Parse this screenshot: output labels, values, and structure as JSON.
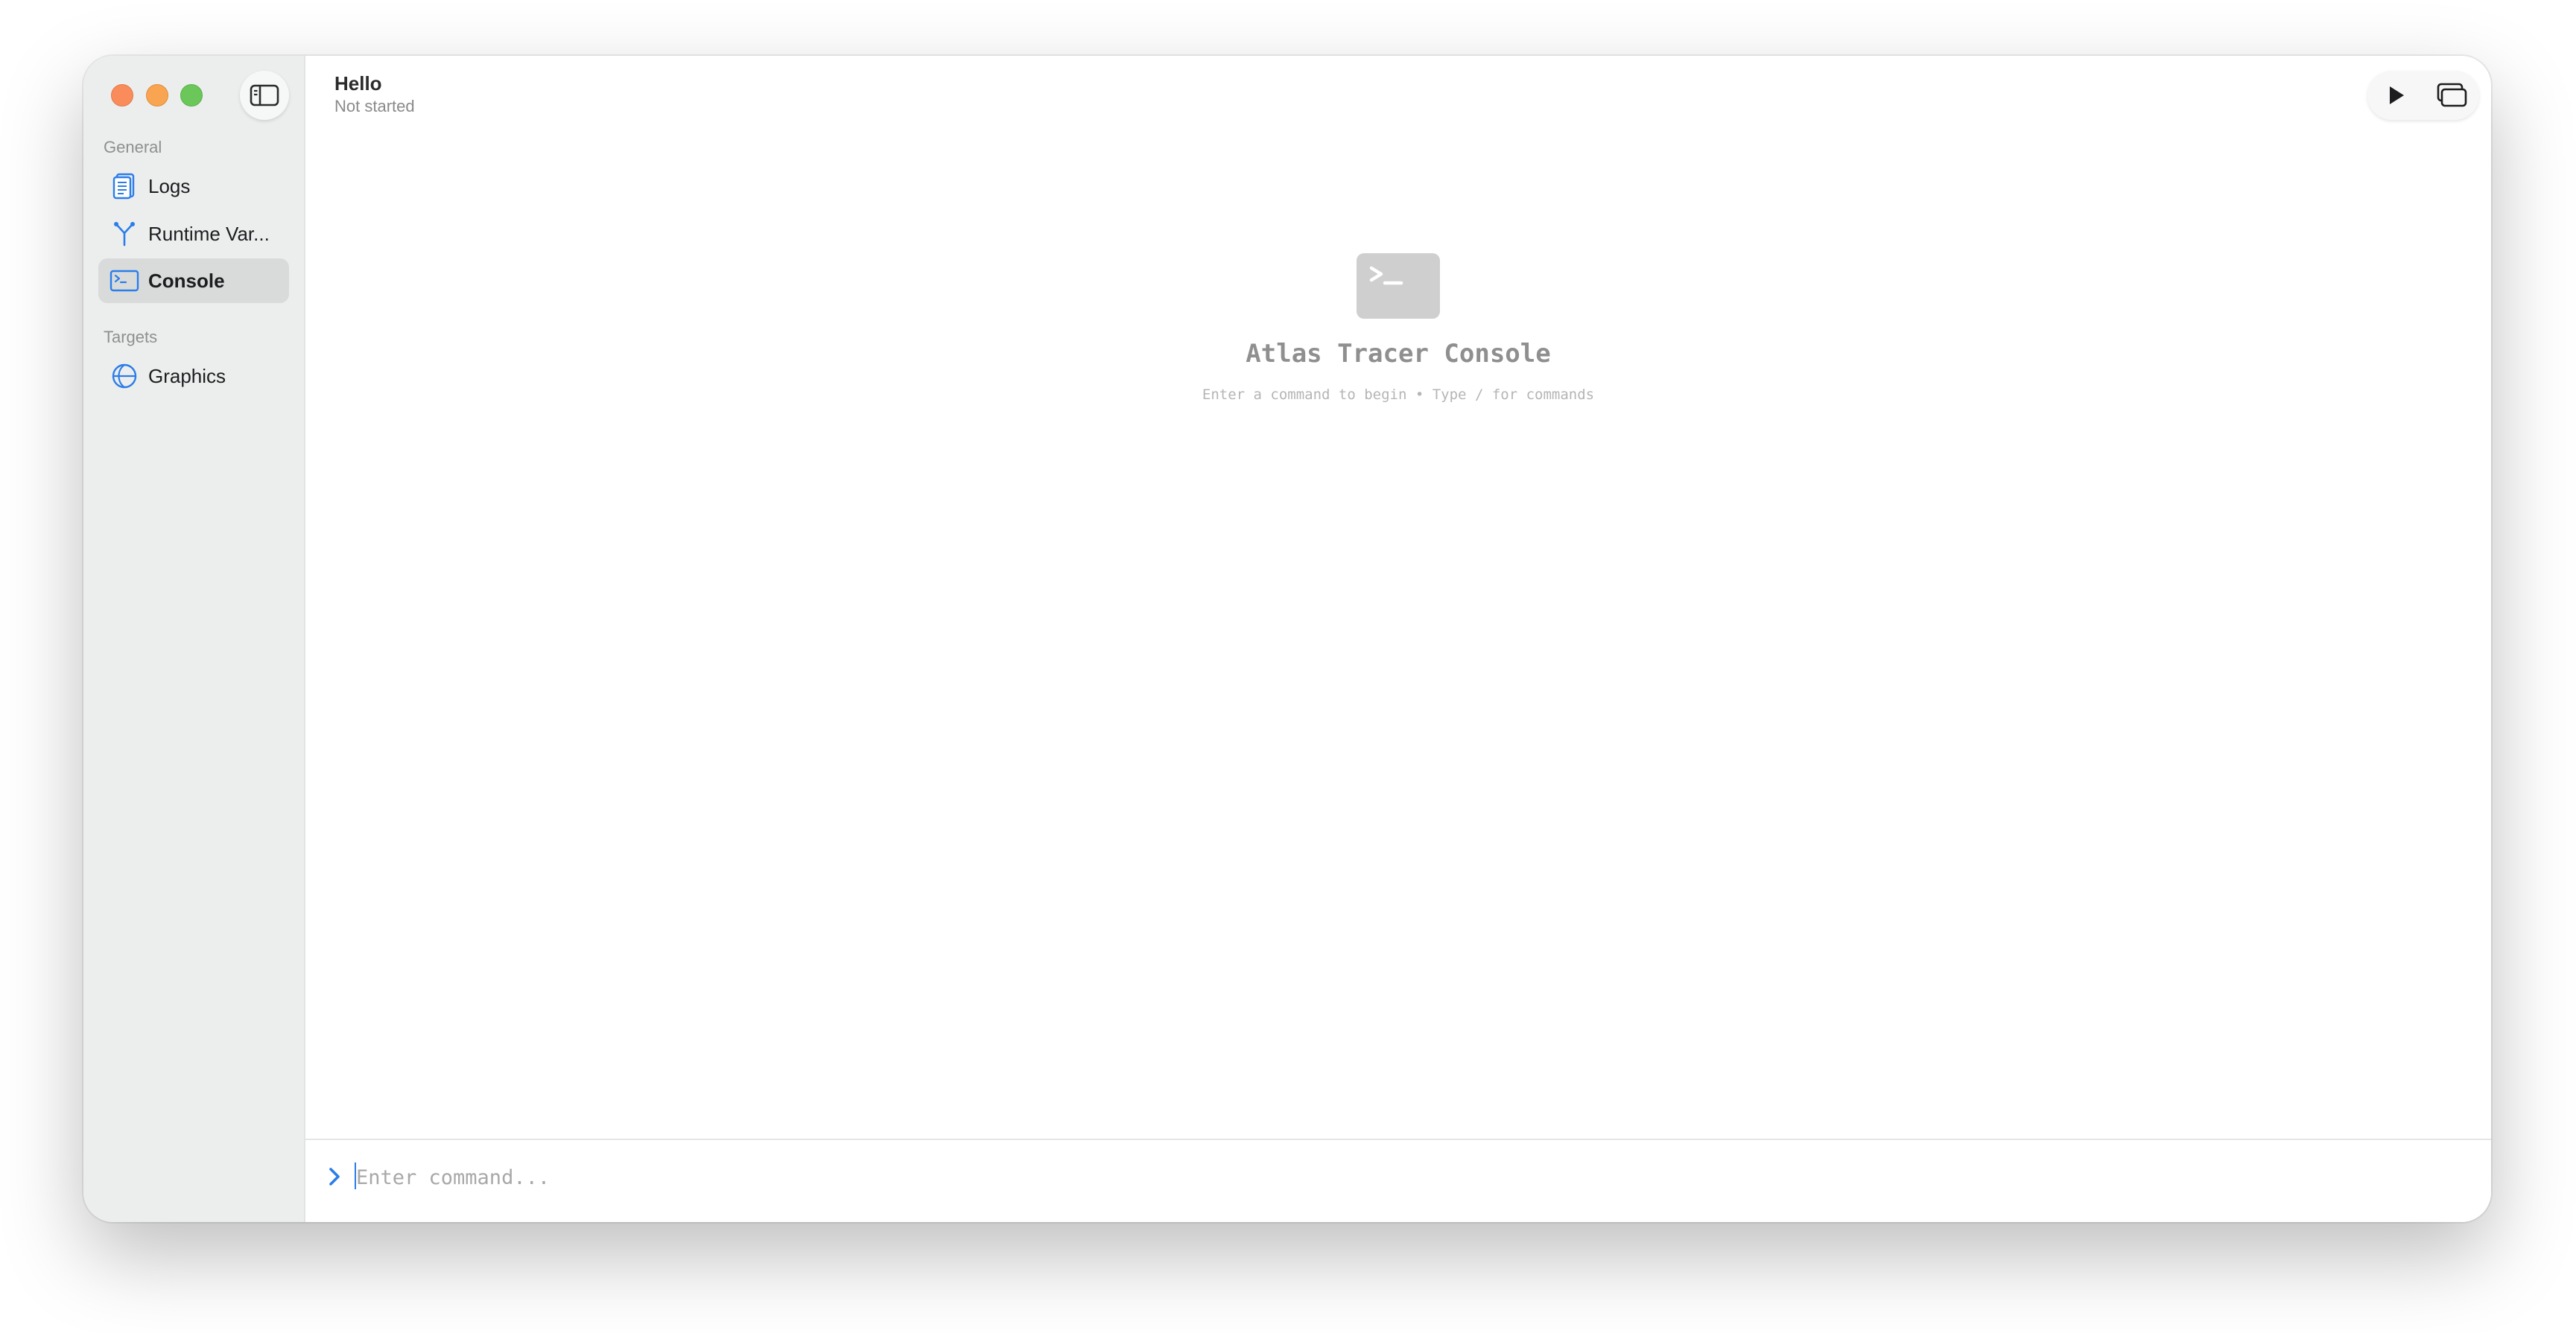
{
  "app": {
    "title": "Hello",
    "status": "Not started"
  },
  "sidebar": {
    "sections": [
      {
        "label": "General",
        "items": [
          {
            "label": "Logs",
            "icon": "document-icon",
            "selected": false
          },
          {
            "label": "Runtime Var...",
            "icon": "branch-icon",
            "selected": false
          },
          {
            "label": "Console",
            "icon": "terminal-icon",
            "selected": true
          }
        ]
      },
      {
        "label": "Targets",
        "items": [
          {
            "label": "Graphics",
            "icon": "globe-icon",
            "selected": false
          }
        ]
      }
    ]
  },
  "toolbar": {
    "run_icon": "play-icon",
    "window_icon": "windows-icon"
  },
  "console": {
    "empty_title": "Atlas Tracer Console",
    "empty_hint": "Enter a command to begin • Type / for commands",
    "input_placeholder": "Enter command...",
    "input_value": ""
  },
  "colors": {
    "accent": "#2b7de9",
    "sidebar_bg": "#eceeee",
    "selected_bg": "#d9dbdb"
  }
}
